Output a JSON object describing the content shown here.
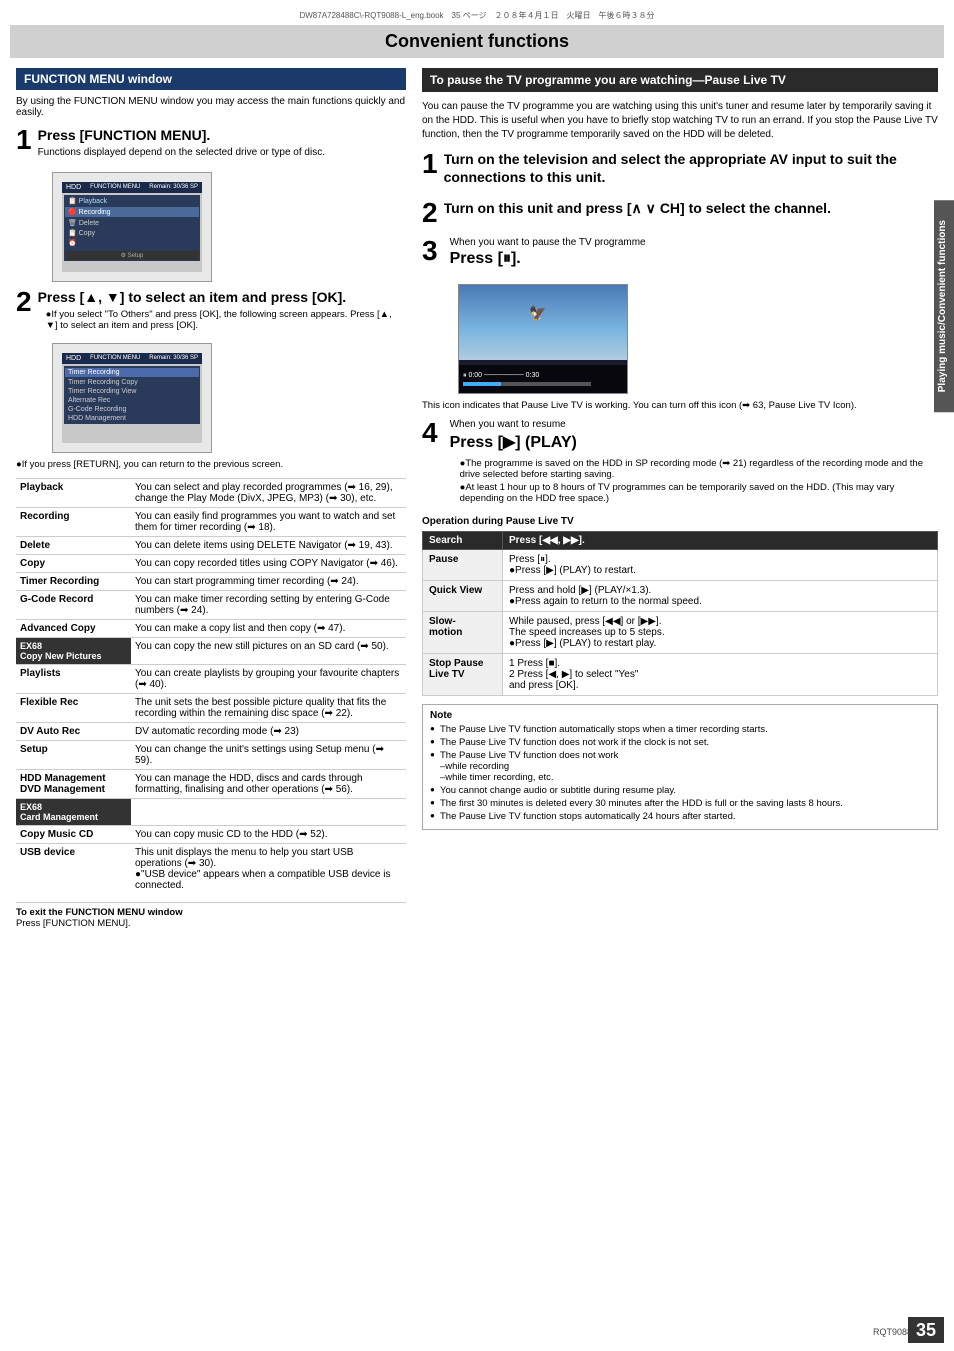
{
  "header": {
    "meta_line": "DW87A728488C\\-RQT9088-L_eng.book　35 ページ　２０８年４月１日　火曜日　午後６時３８分"
  },
  "page_title": "Convenient functions",
  "left_section": {
    "header": "FUNCTION MENU window",
    "intro": "By using the FUNCTION MENU window you may access the main functions quickly and easily.",
    "step1_num": "1",
    "step1_title": "Press [FUNCTION MENU].",
    "step1_sub": "Functions displayed depend on the selected drive or type of disc.",
    "step2_num": "2",
    "step2_title": "Press [▲, ▼] to select an item and press [OK].",
    "step2_note1": "●If you select \"To Others\" and press [OK], the following screen appears. Press [▲, ▼] to select an item and press [OK].",
    "step2_note2": "●If you press [RETURN], you can return to the previous screen.",
    "functions": [
      {
        "name": "Playback",
        "desc": "You can select and play recorded programmes (➡ 16, 29), change the Play Mode (DivX, JPEG, MP3) (➡ 30), etc.",
        "highlighted": false
      },
      {
        "name": "Recording",
        "desc": "You can easily find programmes you want to watch and set them for timer recording (➡ 18).",
        "highlighted": false
      },
      {
        "name": "Delete",
        "desc": "You can delete items using DELETE Navigator (➡ 19, 43).",
        "highlighted": false
      },
      {
        "name": "Copy",
        "desc": "You can copy recorded titles using COPY Navigator (➡ 46).",
        "highlighted": false
      },
      {
        "name": "Timer Recording",
        "desc": "You can start programming timer recording (➡ 24).",
        "highlighted": false
      },
      {
        "name": "G-Code Record",
        "desc": "You can make timer recording setting by entering G-Code numbers (➡ 24).",
        "highlighted": false
      },
      {
        "name": "Advanced Copy",
        "desc": "You can make a copy list and then copy (➡ 47).",
        "highlighted": false
      },
      {
        "name": "EX68\nCopy New Pictures",
        "desc": "You can copy the new still pictures on an SD card (➡ 50).",
        "highlighted": true
      },
      {
        "name": "Playlists",
        "desc": "You can create playlists by grouping your favourite chapters (➡ 40).",
        "highlighted": false
      },
      {
        "name": "Flexible Rec",
        "desc": "The unit sets the best possible picture quality that fits the recording within the remaining disc space (➡ 22).",
        "highlighted": false
      },
      {
        "name": "DV Auto Rec",
        "desc": "DV automatic recording mode (➡ 23)",
        "highlighted": false
      },
      {
        "name": "Setup",
        "desc": "You can change the unit's settings using Setup menu (➡ 59).",
        "highlighted": false
      },
      {
        "name": "HDD Management\nDVD Management",
        "desc": "You can manage the HDD, discs and cards through formatting, finalising and other operations (➡ 56).",
        "highlighted": false
      },
      {
        "name": "EX68\nCard Management",
        "desc": "",
        "highlighted": true
      },
      {
        "name": "Copy Music CD",
        "desc": "You can copy music CD to the HDD (➡ 52).",
        "highlighted": false
      },
      {
        "name": "USB device",
        "desc": "This unit displays the menu to help you start USB operations (➡ 30).\n●\"USB device\" appears when a compatible USB device is connected.",
        "highlighted": false
      }
    ],
    "exit_note_label": "To exit the FUNCTION MENU window",
    "exit_note_text": "Press [FUNCTION MENU]."
  },
  "right_section": {
    "header": "To pause the TV programme you are watching—Pause Live TV",
    "intro": "You can pause the TV programme you are watching using this unit's tuner and resume later by temporarily saving it on the HDD. This is useful when you have to briefly stop watching TV to run an errand.\nIf you stop the Pause Live TV function, then the TV programme temporarily saved on the HDD will be deleted.",
    "step1_num": "1",
    "step1_title": "Turn on the television and select the appropriate AV input to suit the connections to this unit.",
    "step2_num": "2",
    "step2_title": "Turn on this unit and press [∧ ∨ CH] to select the channel.",
    "step3_num": "3",
    "step3_label": "When you want to pause the TV programme",
    "step3_title": "Press [⏸].",
    "step3_icon_note": "This icon indicates that Pause Live TV is working. You can turn off this icon (➡ 63, Pause Live TV Icon).",
    "step4_num": "4",
    "step4_label": "When you want to resume",
    "step4_title": "Press [▶] (PLAY)",
    "step4_note1": "●The programme is saved on the HDD in SP recording mode (➡ 21) regardless of the recording mode and the drive selected before starting saving.",
    "step4_note2": "●At least 1 hour up to 8 hours of TV programmes can be temporarily saved on the HDD. (This may vary depending on the HDD free space.)",
    "op_table_header": "Operation during Pause Live TV",
    "op_table_cols": [
      "",
      ""
    ],
    "op_table_rows": [
      {
        "label": "Search",
        "desc": "Press [◀◀, ▶▶]."
      },
      {
        "label": "Pause",
        "desc": "Press [⏸].\n●Press [▶] (PLAY) to restart."
      },
      {
        "label": "Quick View",
        "desc": "Press and hold [▶] (PLAY/×1.3).\n●Press again to return to the normal speed."
      },
      {
        "label": "Slow-motion",
        "desc": "While paused, press [◀◀] or [▶▶].\nThe speed increases up to 5 steps.\n●Press [▶] (PLAY) to restart play."
      },
      {
        "label": "Stop Pause\nLive TV",
        "desc": "1  Press [■].\n2  Press [◀, ▶] to select \"Yes\" and press [OK]."
      }
    ],
    "notes": [
      "The Pause Live TV function automatically stops when a timer recording starts.",
      "The Pause Live TV function does not work if the clock is not set.",
      "The Pause Live TV function does not work\n–while recording\n–while timer recording, etc.",
      "You cannot change audio or subtitle during resume play.",
      "The first 30 minutes is deleted every 30 minutes after the HDD is full or the saving lasts 8 hours.",
      "The Pause Live TV function stops automatically 24 hours after started."
    ]
  },
  "side_label": "Playing music/Convenient functions",
  "page_number": "35",
  "rqt_ref": "RQT9088"
}
